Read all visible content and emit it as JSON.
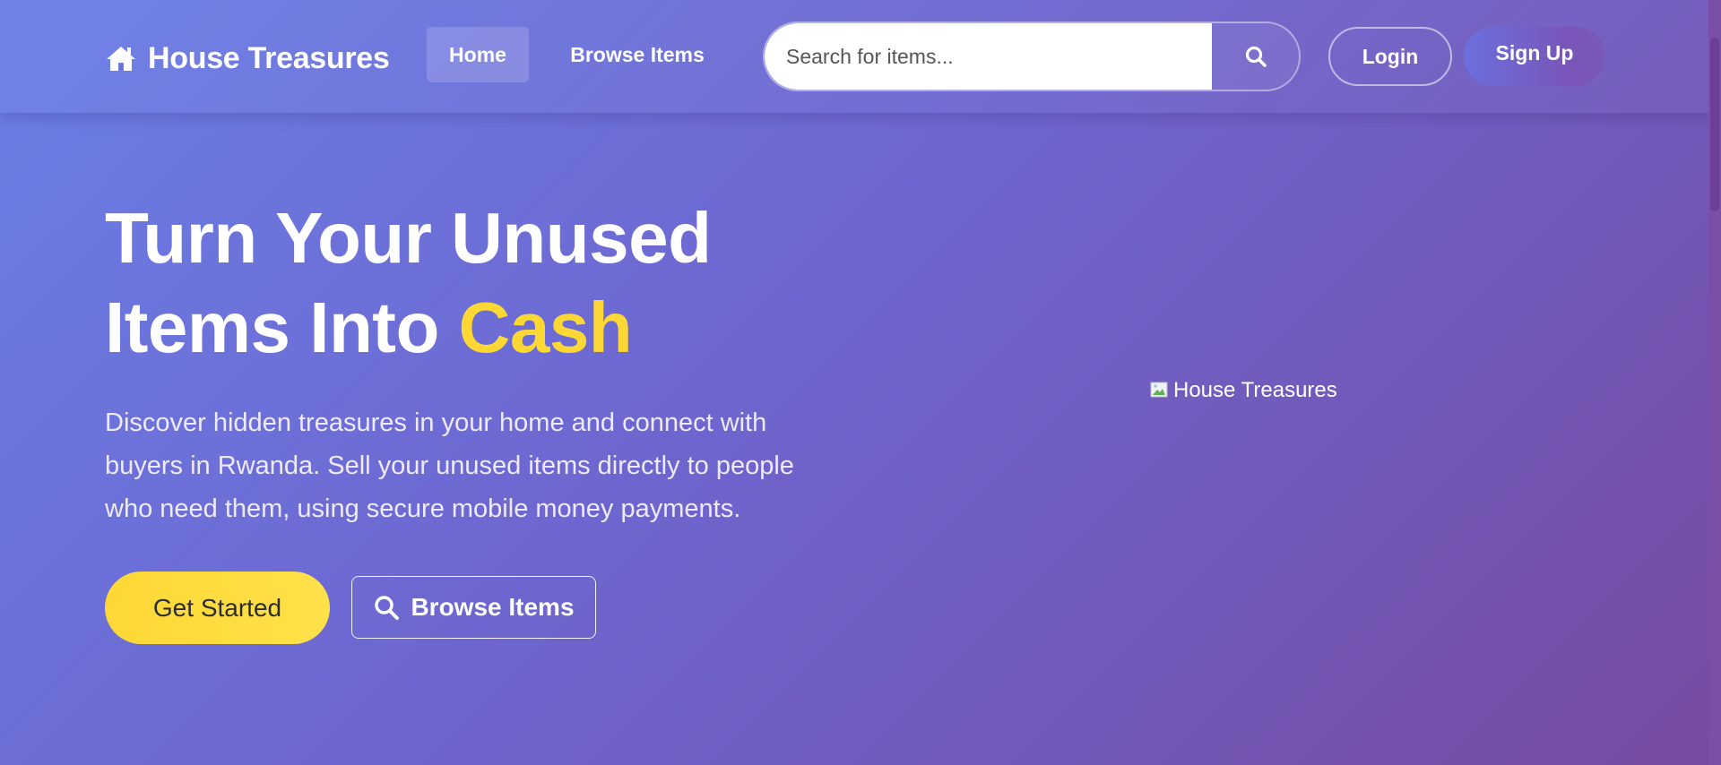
{
  "brand": {
    "name": "House Treasures",
    "icon": "home-icon"
  },
  "nav": {
    "items": [
      {
        "label": "Home",
        "active": true
      },
      {
        "label": "Browse Items",
        "active": false
      }
    ]
  },
  "search": {
    "placeholder": "Search for items...",
    "value": "",
    "button_icon": "search-icon"
  },
  "auth": {
    "login_label": "Login",
    "signup_label": "Sign Up"
  },
  "hero": {
    "title_line1": "Turn Your Unused",
    "title_line2_prefix": "Items Into",
    "title_highlight": "Cash",
    "description": "Discover hidden treasures in your home and connect with buyers in Rwanda. Sell your unused items directly to people who need them, using secure mobile money payments.",
    "cta_primary": "Get Started",
    "cta_secondary": "Browse Items",
    "image_alt": "House Treasures"
  },
  "colors": {
    "gradient_start": "#6a7fe6",
    "gradient_end": "#764ba2",
    "accent_yellow": "#fdd835",
    "text_white": "#ffffff"
  }
}
